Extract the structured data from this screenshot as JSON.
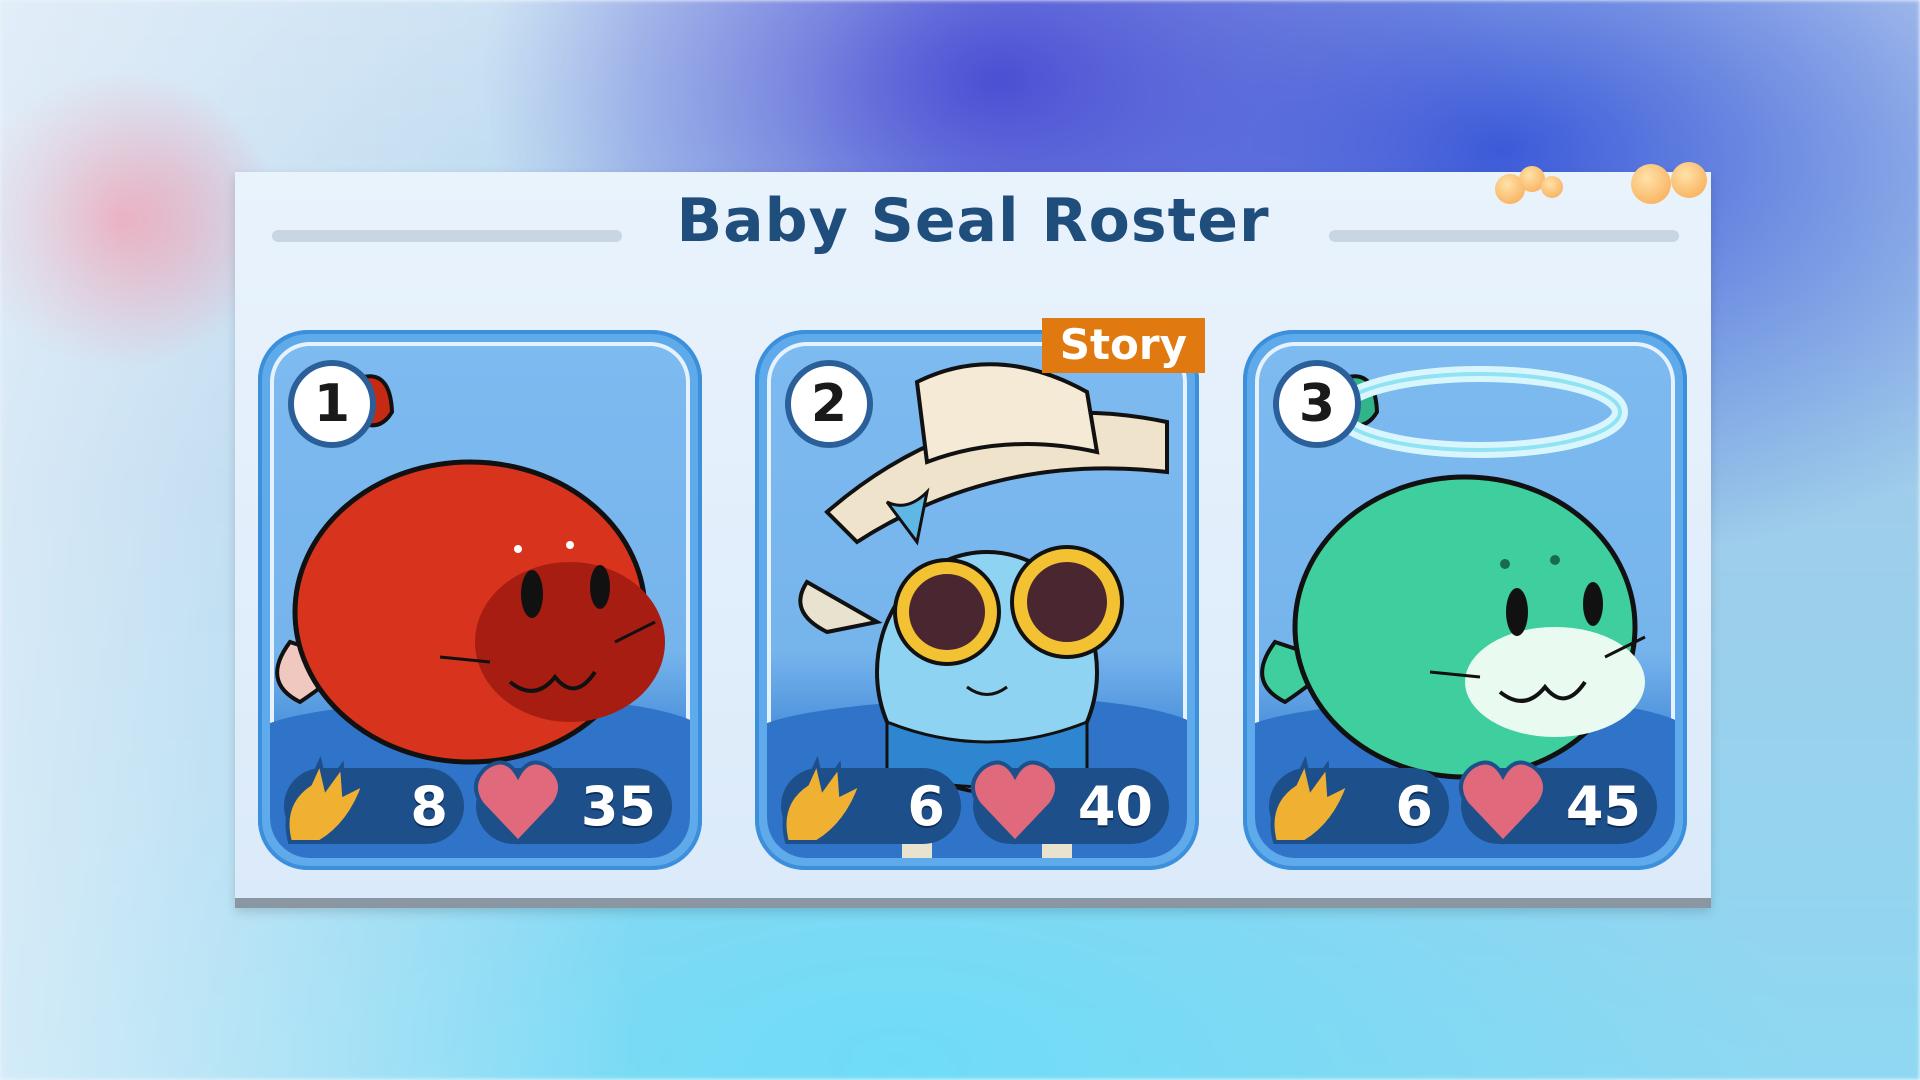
{
  "panel": {
    "title": "Baby Seal Roster"
  },
  "cards": [
    {
      "number": "1",
      "creature": "red-seal",
      "color": "#d8331c",
      "attack": "8",
      "health": "35",
      "tag": ""
    },
    {
      "number": "2",
      "creature": "seal-in-cowboy-hat",
      "color": "#5fb7e6",
      "attack": "6",
      "health": "40",
      "tag": "Story"
    },
    {
      "number": "3",
      "creature": "green-seal-with-halo",
      "color": "#3fcf9e",
      "attack": "6",
      "health": "45",
      "tag": ""
    }
  ],
  "colors": {
    "title": "#1f4e7d",
    "card_border": "#5eaaea",
    "stat_pill": "#1d4f8a",
    "attack_icon": "#f0b133",
    "health_icon": "#e0697b",
    "story_tag": "#e07a10"
  },
  "icons": {
    "attack": "claw-icon",
    "health": "heart-icon"
  }
}
